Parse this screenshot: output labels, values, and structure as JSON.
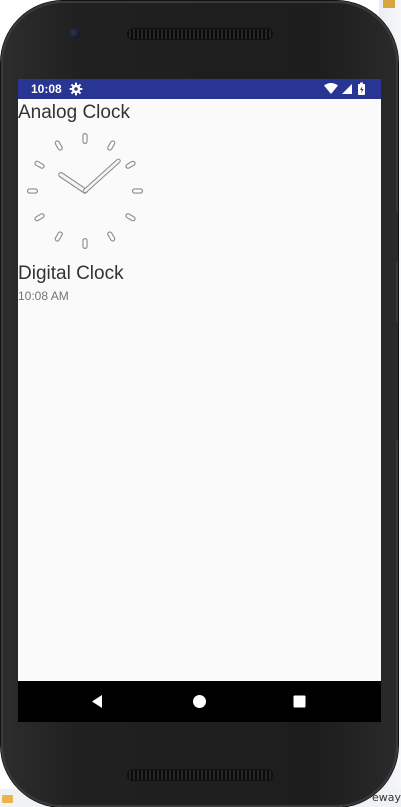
{
  "status_bar": {
    "time": "10:08",
    "settings_icon": "gear-icon",
    "wifi_icon": "wifi-icon",
    "signal_icon": "signal-icon",
    "battery_icon": "battery-icon",
    "color": "#283593"
  },
  "content": {
    "analog_clock_label": "Analog Clock",
    "analog_clock_time": "10:08",
    "digital_clock_label": "Digital Clock",
    "digital_clock_time": "10:08 AM"
  },
  "nav_bar": {
    "back_icon": "back-icon",
    "home_icon": "home-icon",
    "recents_icon": "recents-icon"
  },
  "background": {
    "footer_text": "eway"
  }
}
